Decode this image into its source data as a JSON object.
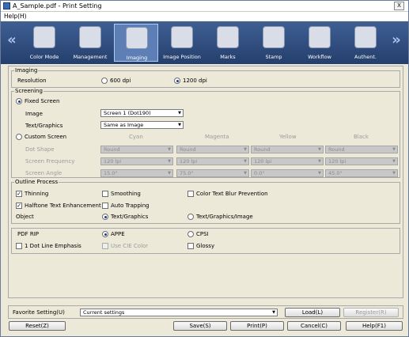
{
  "window": {
    "title": "A_Sample.pdf - Print Setting",
    "close": "X"
  },
  "menu": {
    "help": "Help(H)"
  },
  "toolbar": {
    "items": [
      {
        "label": "Color Mode",
        "icon": "color-mode-icon"
      },
      {
        "label": "Management",
        "icon": "management-icon"
      },
      {
        "label": "Imaging",
        "icon": "imaging-icon",
        "selected": true
      },
      {
        "label": "Image Position",
        "icon": "image-position-icon"
      },
      {
        "label": "Marks",
        "icon": "marks-icon"
      },
      {
        "label": "Stamp",
        "icon": "stamp-icon"
      },
      {
        "label": "Workflow",
        "icon": "workflow-icon"
      },
      {
        "label": "Authent.",
        "icon": "authentication-icon"
      }
    ],
    "prev_arrow": "«",
    "next_arrow": "»"
  },
  "imaging": {
    "group": "Imaging",
    "resolution_label": "Resolution",
    "opt_600": "600 dpi",
    "opt_1200": "1200 dpi",
    "selected": "1200 dpi"
  },
  "screening": {
    "group": "Screening",
    "fixed_label": "Fixed Screen",
    "image_label": "Image",
    "image_value": "Screen 1 (Dot190)",
    "text_label": "Text/Graphics",
    "text_value": "Same as Image",
    "custom_label": "Custom Screen",
    "columns": [
      "Cyan",
      "Magenta",
      "Yellow",
      "Black"
    ],
    "rows": [
      {
        "label": "Dot Shape",
        "values": [
          "Round",
          "Round",
          "Round",
          "Round"
        ]
      },
      {
        "label": "Screen Frequency",
        "values": [
          "120 lpi",
          "120 lpi",
          "120 lpi",
          "120 lpi"
        ]
      },
      {
        "label": "Screen Angle",
        "values": [
          "15.0°",
          "75.0°",
          "0.0°",
          "45.0°"
        ]
      }
    ]
  },
  "outline": {
    "group": "Outline Process",
    "thinning": "Thinning",
    "smoothing": "Smoothing",
    "color_text_blur": "Color Text Blur Prevention",
    "halftone": "Halftone Text Enhancement",
    "auto_trapping": "Auto Trapping",
    "object_label": "Object",
    "object_text": "Text/Graphics",
    "object_text_image": "Text/Graphics/Image"
  },
  "pdf": {
    "rip_label": "PDF RIP",
    "appe": "APPE",
    "cpsi": "CPSI",
    "one_dot": "1 Dot Line Emphasis",
    "cie": "Use CIE Color",
    "glossy": "Glossy"
  },
  "favorite": {
    "label": "Favorite Setting(U)",
    "value": "Current settings",
    "load": "Load(L)",
    "register": "Register(R)"
  },
  "footer": {
    "reset": "Reset(Z)",
    "save": "Save(S)",
    "print": "Print(P)",
    "cancel": "Cancel(C)",
    "help": "Help(F1)"
  }
}
